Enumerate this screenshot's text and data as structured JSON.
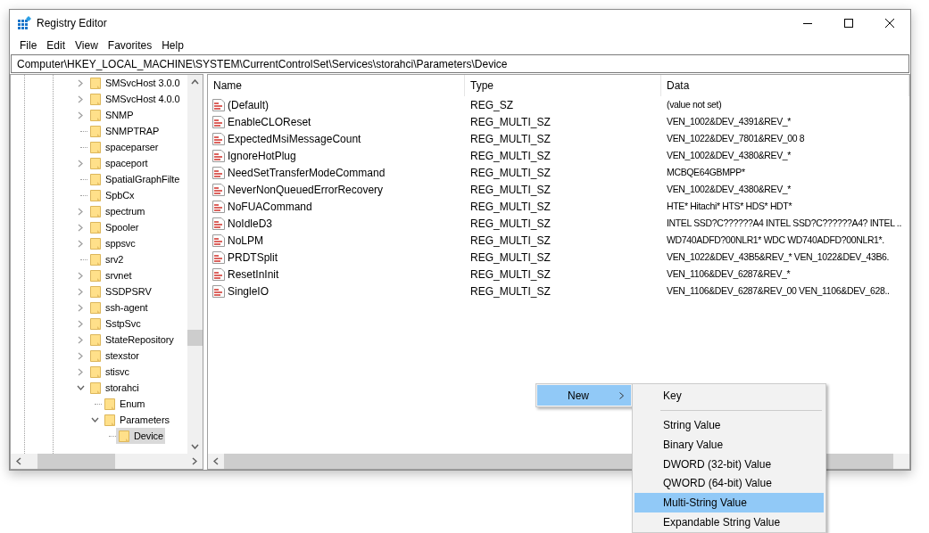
{
  "window": {
    "title": "Registry Editor"
  },
  "menu": [
    {
      "label": "File"
    },
    {
      "label": "Edit"
    },
    {
      "label": "View"
    },
    {
      "label": "Favorites"
    },
    {
      "label": "Help"
    }
  ],
  "address": "Computer\\HKEY_LOCAL_MACHINE\\SYSTEM\\CurrentControlSet\\Services\\storahci\\Parameters\\Device",
  "tree": {
    "items": [
      {
        "label": "SMSvcHost 3.0.0",
        "expandable": true,
        "expanded": false,
        "selected": false
      },
      {
        "label": "SMSvcHost 4.0.0",
        "expandable": true,
        "expanded": false,
        "selected": false
      },
      {
        "label": "SNMP",
        "expandable": true,
        "expanded": false,
        "selected": false
      },
      {
        "label": "SNMPTRAP",
        "expandable": false,
        "selected": false
      },
      {
        "label": "spaceparser",
        "expandable": false,
        "selected": false
      },
      {
        "label": "spaceport",
        "expandable": true,
        "expanded": false,
        "selected": false
      },
      {
        "label": "SpatialGraphFilte",
        "expandable": false,
        "selected": false
      },
      {
        "label": "SpbCx",
        "expandable": false,
        "selected": false
      },
      {
        "label": "spectrum",
        "expandable": true,
        "expanded": false,
        "selected": false
      },
      {
        "label": "Spooler",
        "expandable": true,
        "expanded": false,
        "selected": false
      },
      {
        "label": "sppsvc",
        "expandable": true,
        "expanded": false,
        "selected": false
      },
      {
        "label": "srv2",
        "expandable": false,
        "selected": false
      },
      {
        "label": "srvnet",
        "expandable": true,
        "expanded": false,
        "selected": false
      },
      {
        "label": "SSDPSRV",
        "expandable": true,
        "expanded": false,
        "selected": false
      },
      {
        "label": "ssh-agent",
        "expandable": true,
        "expanded": false,
        "selected": false
      },
      {
        "label": "SstpSvc",
        "expandable": true,
        "expanded": false,
        "selected": false
      },
      {
        "label": "StateRepository",
        "expandable": true,
        "expanded": false,
        "selected": false
      },
      {
        "label": "stexstor",
        "expandable": true,
        "expanded": false,
        "selected": false
      },
      {
        "label": "stisvc",
        "expandable": true,
        "expanded": false,
        "selected": false
      },
      {
        "label": "storahci",
        "expandable": true,
        "expanded": true,
        "selected": false,
        "children": [
          {
            "label": "Enum",
            "expandable": false,
            "selected": false
          },
          {
            "label": "Parameters",
            "expandable": true,
            "expanded": true,
            "selected": false,
            "children": [
              {
                "label": "Device",
                "expandable": false,
                "selected": true
              }
            ]
          }
        ]
      }
    ]
  },
  "values": {
    "columns": [
      "Name",
      "Type",
      "Data"
    ],
    "rows": [
      {
        "name": "(Default)",
        "type": "REG_SZ",
        "data": "(value not set)"
      },
      {
        "name": "EnableCLOReset",
        "type": "REG_MULTI_SZ",
        "data": "VEN_1002&DEV_4391&REV_*"
      },
      {
        "name": "ExpectedMsiMessageCount",
        "type": "REG_MULTI_SZ",
        "data": "VEN_1022&DEV_7801&REV_00 8"
      },
      {
        "name": "IgnoreHotPlug",
        "type": "REG_MULTI_SZ",
        "data": "VEN_1002&DEV_4380&REV_*"
      },
      {
        "name": "NeedSetTransferModeCommand",
        "type": "REG_MULTI_SZ",
        "data": "MCBQE64GBMPP*"
      },
      {
        "name": "NeverNonQueuedErrorRecovery",
        "type": "REG_MULTI_SZ",
        "data": "VEN_1002&DEV_4380&REV_*"
      },
      {
        "name": "NoFUACommand",
        "type": "REG_MULTI_SZ",
        "data": "HTE* Hitachi* HTS* HDS* HDT*"
      },
      {
        "name": "NoIdleD3",
        "type": "REG_MULTI_SZ",
        "data": "INTEL SSD?C??????A4 INTEL SSD?C??????A4? INTEL .."
      },
      {
        "name": "NoLPM",
        "type": "REG_MULTI_SZ",
        "data": "WD740ADFD?00NLR1* WDC WD740ADFD?00NLR1*."
      },
      {
        "name": "PRDTSplit",
        "type": "REG_MULTI_SZ",
        "data": "VEN_1022&DEV_43B5&REV_* VEN_1022&DEV_43B6."
      },
      {
        "name": "ResetInInit",
        "type": "REG_MULTI_SZ",
        "data": "VEN_1106&DEV_6287&REV_*"
      },
      {
        "name": "SingleIO",
        "type": "REG_MULTI_SZ",
        "data": "VEN_1106&DEV_6287&REV_00 VEN_1106&DEV_628.."
      }
    ]
  },
  "context_menu": {
    "items": [
      {
        "label": "New",
        "selected": true
      }
    ],
    "submenu": [
      {
        "label": "Key",
        "selected": false
      },
      {
        "kind": "separator"
      },
      {
        "label": "String Value",
        "selected": false
      },
      {
        "label": "Binary Value",
        "selected": false
      },
      {
        "label": "DWORD (32-bit) Value",
        "selected": false
      },
      {
        "label": "QWORD (64-bit) Value",
        "selected": false
      },
      {
        "label": "Multi-String Value",
        "selected": true
      },
      {
        "label": "Expandable String Value",
        "selected": false
      }
    ]
  }
}
